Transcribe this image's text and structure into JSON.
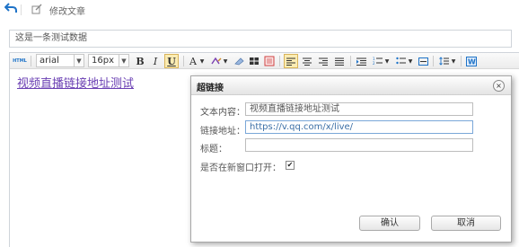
{
  "header": {
    "title": "修改文章"
  },
  "article": {
    "title_value": "这是一条测试数据"
  },
  "toolbar": {
    "html_label": "HTML",
    "font_family": "arial",
    "font_size": "16px",
    "bold": "B",
    "italic": "I",
    "underline": "U",
    "font_color": "A"
  },
  "editor": {
    "content_link_text": "视频直播链接地址测试"
  },
  "link_dialog": {
    "title": "超链接",
    "close": "×",
    "text_label": "文本内容：",
    "text_value": "视频直播链接地址测试",
    "url_label": "链接地址：",
    "url_value": "https://v.qq.com/x/live/",
    "title_label": "标题：",
    "title_value": "",
    "new_window_label": "是否在新窗口打开：",
    "new_window_checked": true,
    "confirm_label": "确认",
    "cancel_label": "取消"
  }
}
